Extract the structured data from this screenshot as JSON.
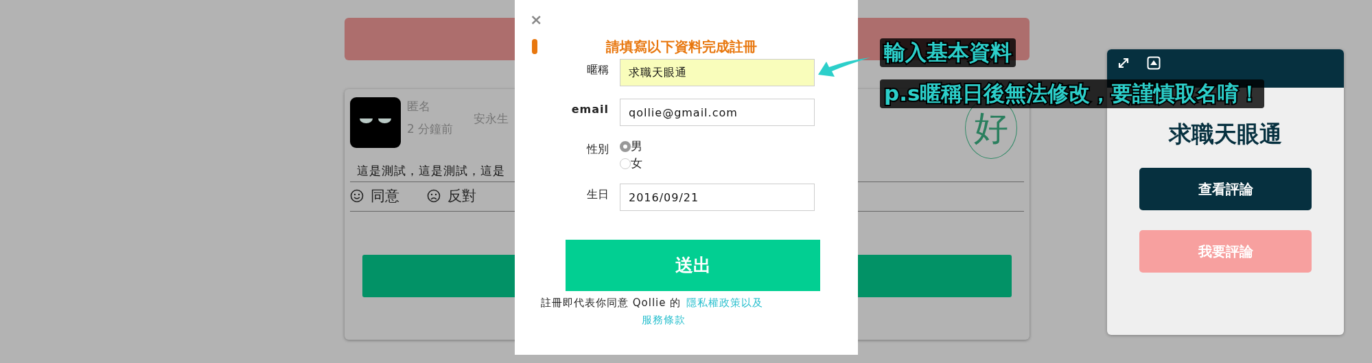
{
  "background_page": {
    "post": {
      "author": "匿名",
      "time": "2 分鐘前",
      "company": "安永生",
      "stamp": "好",
      "body": "這是測試，這是測試，這是",
      "reactions": [
        {
          "kind": "agree",
          "label": "同意"
        },
        {
          "kind": "disagree",
          "label": "反對"
        }
      ]
    }
  },
  "modal": {
    "close": "×",
    "heading": "請填寫以下資料完成註冊",
    "fields": [
      {
        "kind": "text",
        "label": "暱稱",
        "value": "求職天眼通",
        "highlighted": true
      },
      {
        "kind": "text",
        "label": "email",
        "value": "qollie@gmail.com",
        "highlighted": false
      },
      {
        "kind": "radio",
        "label": "性別",
        "options": [
          {
            "label": "男",
            "selected": true
          },
          {
            "label": "女",
            "selected": false
          }
        ]
      },
      {
        "kind": "text",
        "label": "生日",
        "value": "2016/09/21",
        "highlighted": false
      }
    ],
    "submit": "送出",
    "terms": {
      "text": "註冊即代表你同意 Qollie 的",
      "privacy_link": "隱私權政策以及",
      "service_link": "服務條款"
    }
  },
  "side_panel": {
    "title": "求職天眼通",
    "buttons": [
      {
        "kind": "primary",
        "label": "查看評論"
      },
      {
        "kind": "secondary",
        "label": "我要評論"
      }
    ]
  },
  "annotation": {
    "lines": [
      "輸入基本資料",
      "p.s暱稱日後無法修改，要謹慎取名唷！"
    ]
  }
}
